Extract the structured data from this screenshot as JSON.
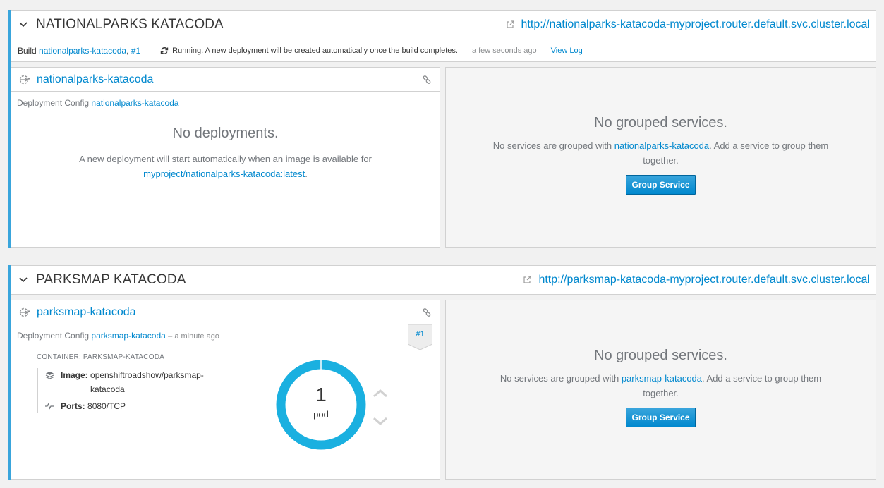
{
  "colors": {
    "accent": "#39a5dc",
    "link": "#0088ce",
    "donut": "#1ab0e0"
  },
  "apps": [
    {
      "title": "NATIONALPARKS KATACODA",
      "route": "http://nationalparks-katacoda-myproject.router.default.svc.cluster.local",
      "build": {
        "prefix": "Build",
        "name": "nationalparks-katacoda",
        "number": "#1",
        "status": "Running. A new deployment will be created automatically once the build completes.",
        "time": "a few seconds ago",
        "view_log": "View Log"
      },
      "dc": {
        "name": "nationalparks-katacoda",
        "config_label": "Deployment Config",
        "config_name": "nationalparks-katacoda",
        "empty_title": "No deployments.",
        "empty_text": "A new deployment will start automatically when an image is available for",
        "image_link": "myproject/nationalparks-katacoda:latest"
      },
      "group": {
        "title": "No grouped services.",
        "text_before": "No services are grouped with ",
        "text_link": "nationalparks-katacoda",
        "text_after": ". Add a service to group them together.",
        "button": "Group Service"
      }
    },
    {
      "title": "PARKSMAP KATACODA",
      "route": "http://parksmap-katacoda-myproject.router.default.svc.cluster.local",
      "dc": {
        "name": "parksmap-katacoda",
        "config_label": "Deployment Config",
        "config_name": "parksmap-katacoda",
        "config_time": "a minute ago",
        "deployment_badge": "#1",
        "container_label": "CONTAINER: PARKSMAP-KATACODA",
        "image_label": "Image:",
        "image_value": "openshiftroadshow/parksmap-katacoda",
        "ports_label": "Ports:",
        "ports_value": "8080/TCP",
        "pod_count": "1",
        "pod_label": "pod"
      },
      "group": {
        "title": "No grouped services.",
        "text_before": "No services are grouped with ",
        "text_link": "parksmap-katacoda",
        "text_after": ". Add a service to group them together.",
        "button": "Group Service"
      }
    }
  ],
  "icons": [
    "chevron-down-icon",
    "external-link-icon",
    "refresh-icon",
    "deployment-config-icon",
    "chain-link-icon",
    "layers-icon",
    "pulse-icon",
    "chevron-up-icon"
  ]
}
